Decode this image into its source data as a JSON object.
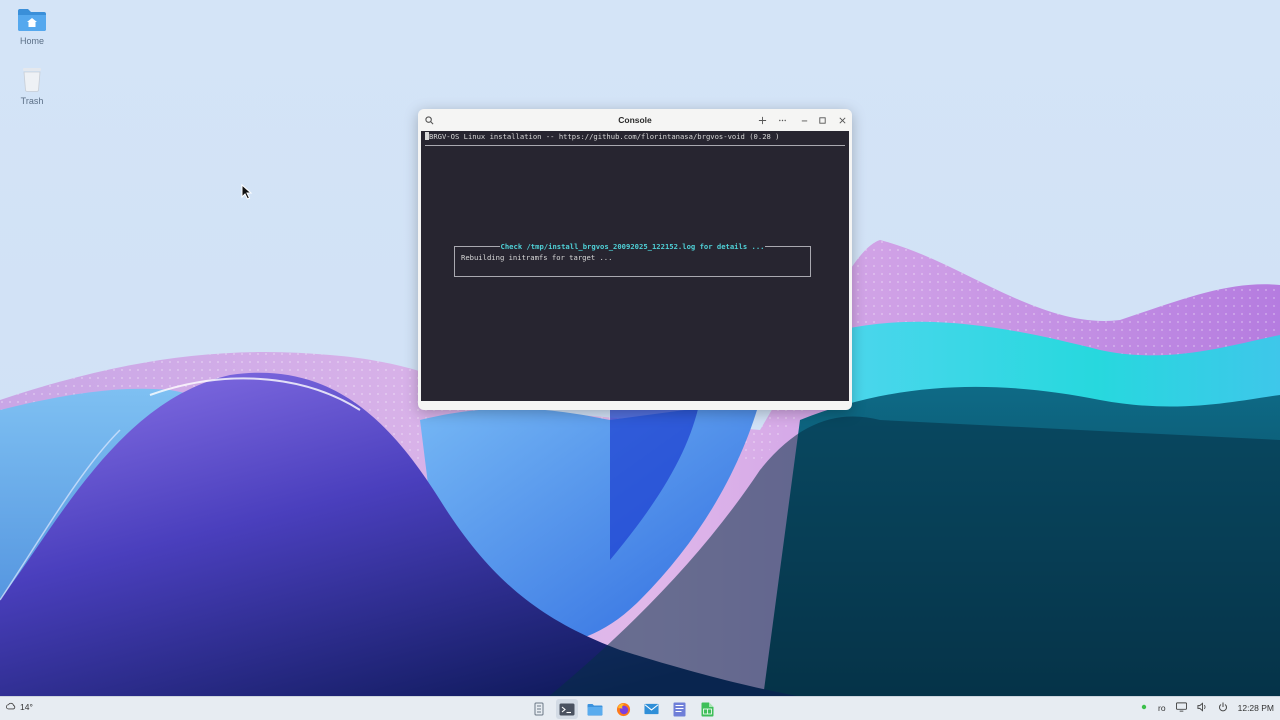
{
  "desktop": {
    "icons": [
      {
        "label": "Home",
        "icon": "folder-home-icon"
      },
      {
        "label": "Trash",
        "icon": "trash-icon"
      }
    ]
  },
  "window": {
    "title": "Console",
    "controls": [
      "search-icon",
      "new-tab-icon",
      "more-icon",
      "minimize-icon",
      "maximize-icon",
      "close-icon"
    ]
  },
  "terminal": {
    "header": "BRGV-OS Linux installation -- https://github.com/florintanasa/brgvos-void (0.28 )",
    "dialog_title": "Check /tmp/install_brgvos_20092025_122152.log for details ...",
    "dialog_message": "Rebuilding initramfs for target ...",
    "bg_color": "#272530",
    "accent_color": "#4fd0d6"
  },
  "taskbar": {
    "weather": "14°",
    "apps": [
      {
        "name": "app-launcher-icon"
      },
      {
        "name": "terminal-icon",
        "active": true
      },
      {
        "name": "file-manager-icon"
      },
      {
        "name": "firefox-icon"
      },
      {
        "name": "mail-icon"
      },
      {
        "name": "text-editor-icon"
      },
      {
        "name": "spreadsheet-icon"
      }
    ],
    "tray": {
      "keyboard_layout": "ro",
      "clock": "12:28 PM"
    }
  }
}
